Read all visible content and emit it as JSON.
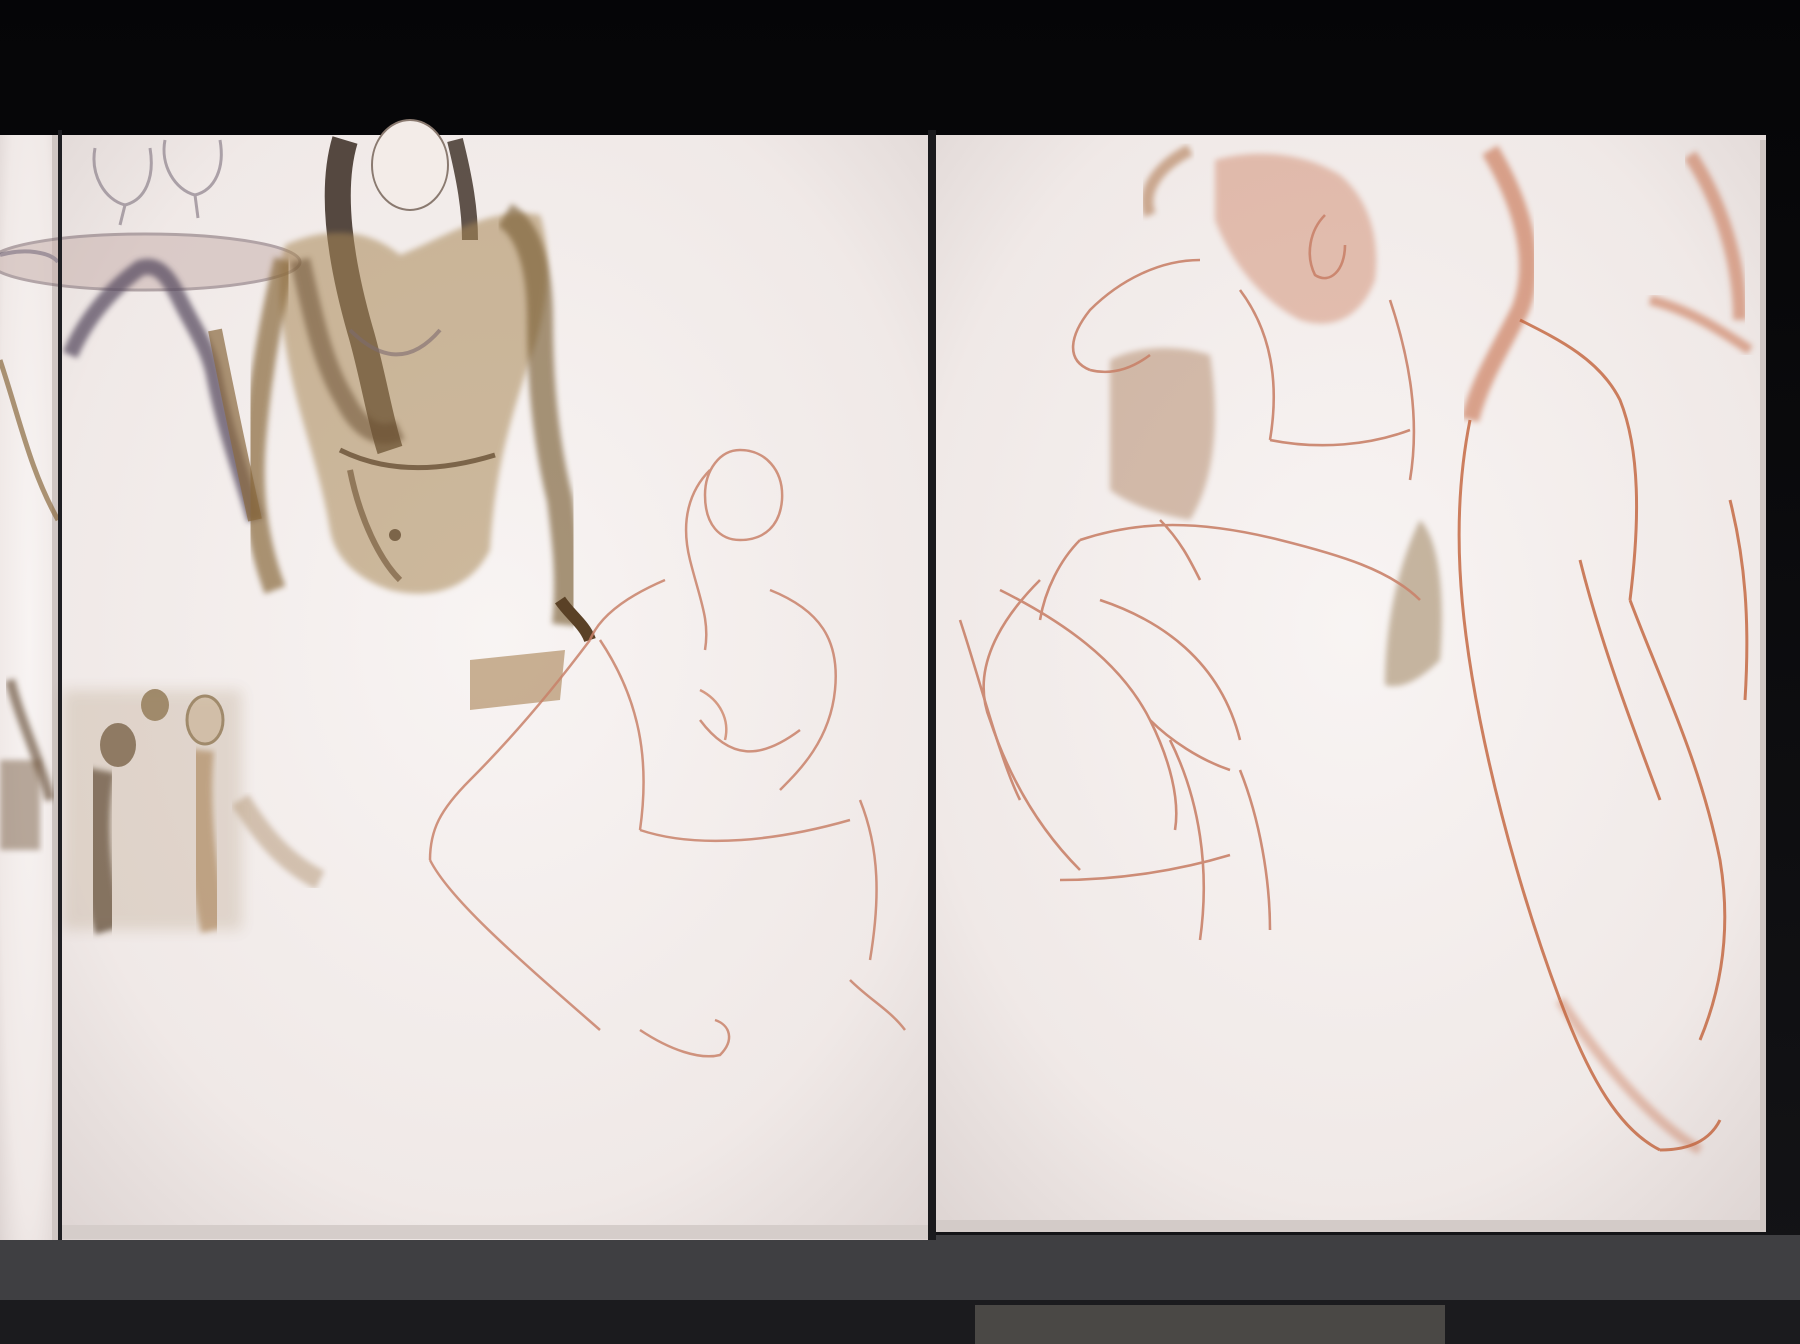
{
  "scene": {
    "subject": "studio-wall-with-unfinished-figure-paintings",
    "canvases": [
      {
        "id": "left-edge-canvas",
        "figures": [
          "partial-arm-sketch",
          "seated-audience-figures"
        ]
      },
      {
        "id": "center-canvas",
        "figures": [
          "standing-woman-with-tray",
          "wine-glasses",
          "leaning-woman-sketch"
        ]
      },
      {
        "id": "right-canvas",
        "figures": [
          "seated-woman-sketch",
          "partial-nude-figure"
        ]
      }
    ]
  },
  "colors": {
    "background": "#0d0d0f",
    "canvas": "#f2ecea",
    "canvas_shadow": "#d9d1cf",
    "shelf": "#3f3f42",
    "sepia_dark": "#5a4126",
    "umber": "#8a6a3e",
    "ochre": "#b88a55",
    "red_chalk": "#c2623a",
    "sketch_line": "#c9826a",
    "grey_blue": "#6f6f88"
  }
}
